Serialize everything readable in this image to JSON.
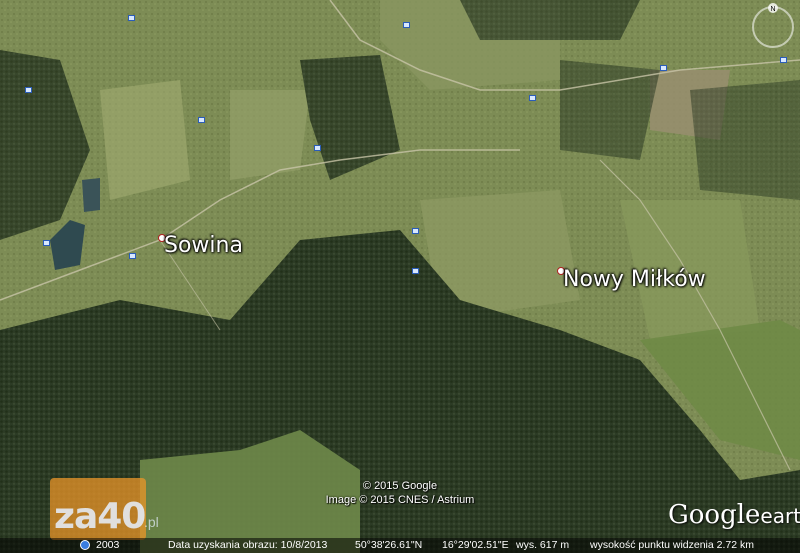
{
  "map": {
    "places": [
      {
        "name": "Sowina"
      },
      {
        "name": "Nowy Miłków"
      }
    ]
  },
  "attribution": {
    "line1": "© 2015 Google",
    "line2": "Image © 2015 CNES / Astrium"
  },
  "watermark": {
    "text": "za40",
    "suffix": ".pl"
  },
  "logo": {
    "google": "Google",
    "earth": "earth"
  },
  "status_bar": {
    "year": "2003",
    "image_date": "Data uzyskania obrazu: 10/8/2013",
    "latitude": "50°38'26.61\"N",
    "longitude": "16°29'02.51\"E",
    "elevation": "wys.  617 m",
    "eye_altitude": "wysokość punktu widzenia   2.72 km"
  },
  "compass": {
    "north_label": "N"
  },
  "colors": {
    "forest": "#2a3a22",
    "field": "#7f8f56",
    "photo_icon_border": "#2b5db8",
    "watermark": "#eb9628"
  }
}
